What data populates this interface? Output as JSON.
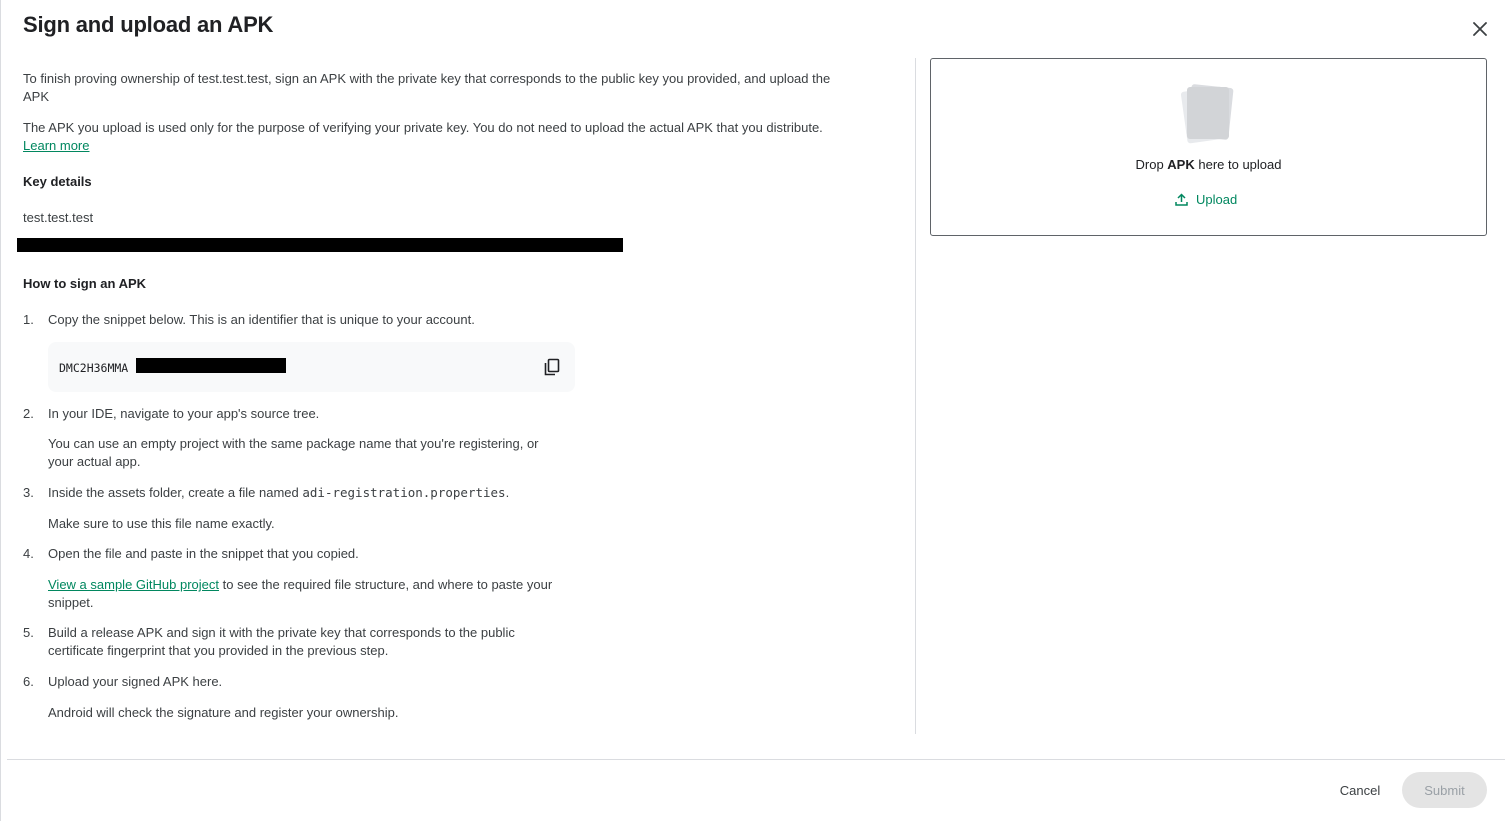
{
  "dialog": {
    "title": "Sign and upload an APK",
    "close_icon": "close-icon"
  },
  "intro": {
    "p1": "To finish proving ownership of test.test.test, sign an APK with the private key that corresponds to the public key you provided, and upload the APK",
    "p2_text": "The APK you upload is used only for the purpose of verifying your private key. You do not need to upload the actual APK that you distribute.",
    "p2_link": "Learn more"
  },
  "key_details": {
    "heading": "Key details",
    "package": "test.test.test"
  },
  "how_to": {
    "heading": "How to sign an APK",
    "snippet_prefix": "DMC2H36MMA",
    "copy_icon": "copy-icon",
    "steps": [
      {
        "num": "1.",
        "text": "Copy the snippet below. This is an identifier that is unique to your account."
      },
      {
        "num": "2.",
        "text": "In your IDE, navigate to your app's source tree.",
        "sub": "You can use an empty project with the same package name that you're registering, or your actual app."
      },
      {
        "num": "3.",
        "text_before": "Inside the assets folder, create a file named ",
        "code": "adi-registration.properties",
        "text_after": ".",
        "sub": "Make sure to use this file name exactly."
      },
      {
        "num": "4.",
        "text": "Open the file and paste in the snippet that you copied.",
        "sub_link": "View a sample GitHub project",
        "sub_after": " to see the required file structure, and where to paste your snippet."
      },
      {
        "num": "5.",
        "text": "Build a release APK and sign it with the private key that corresponds to the public certificate fingerprint that you provided in the previous step."
      },
      {
        "num": "6.",
        "text": "Upload your signed APK here.",
        "sub": "Android will check the signature and register your ownership."
      }
    ]
  },
  "dropzone": {
    "text_before": "Drop ",
    "text_bold": "APK",
    "text_after": " here to upload",
    "upload_label": "Upload",
    "upload_icon": "upload-icon",
    "graphic_icon": "file-stack-icon"
  },
  "footer": {
    "cancel_label": "Cancel",
    "submit_label": "Submit"
  },
  "colors": {
    "accent": "#01875f",
    "text": "#3c4043",
    "divider": "#dadce0",
    "submit_disabled_bg": "#e4e4e4"
  }
}
